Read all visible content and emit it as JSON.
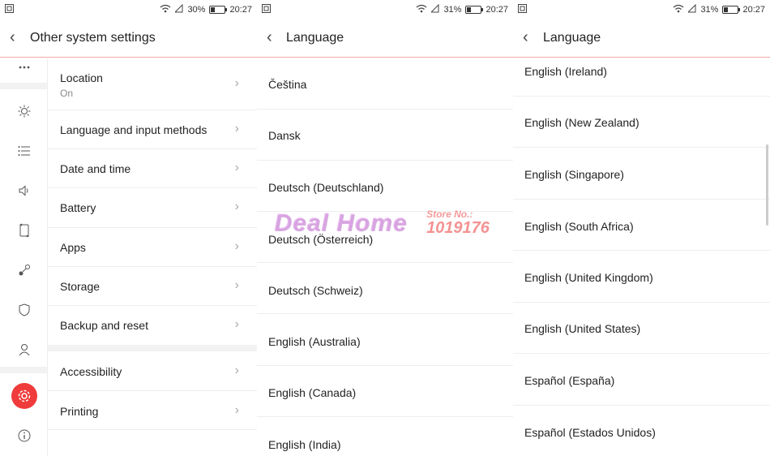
{
  "panels": [
    {
      "status": {
        "left_icon": "screenshot-icon",
        "battery": "30%",
        "battery_fill": 0.3,
        "time": "20:27"
      },
      "title": "Other system settings",
      "rail_icons": [
        "more-icon",
        "brightness-icon",
        "list-icon",
        "sound-icon",
        "screen-rotate-icon",
        "link-icon",
        "shield-icon",
        "account-icon",
        "settings-icon",
        "info-icon"
      ],
      "items": [
        {
          "label": "Location",
          "sub": "On"
        },
        {
          "label": "Language and input methods"
        },
        {
          "label": "Date and time"
        },
        {
          "label": "Battery"
        },
        {
          "label": "Apps"
        },
        {
          "label": "Storage"
        },
        {
          "label": "Backup and reset"
        },
        {
          "label": "Accessibility"
        },
        {
          "label": "Printing"
        }
      ]
    },
    {
      "status": {
        "left_icon": "screenshot-icon",
        "battery": "31%",
        "battery_fill": 0.31,
        "time": "20:27"
      },
      "title": "Language",
      "languages": [
        "Čeština",
        "Dansk",
        "Deutsch (Deutschland)",
        "Deutsch (Österreich)",
        "Deutsch (Schweiz)",
        "English (Australia)",
        "English (Canada)",
        "English (India)"
      ]
    },
    {
      "status": {
        "left_icon": "screenshot-icon",
        "battery": "31%",
        "battery_fill": 0.31,
        "time": "20:27"
      },
      "title": "Language",
      "languages": [
        "English (Ireland)",
        "English (New Zealand)",
        "English (Singapore)",
        "English (South Africa)",
        "English (United Kingdom)",
        "English (United States)",
        "Español (España)",
        "Español (Estados Unidos)"
      ]
    }
  ],
  "watermark": {
    "logo": "Deal Home",
    "store_label": "Store No.:",
    "store_number": "1019176"
  },
  "colors": {
    "accent": "#ef3b3b",
    "divider": "#f2a8a8"
  }
}
